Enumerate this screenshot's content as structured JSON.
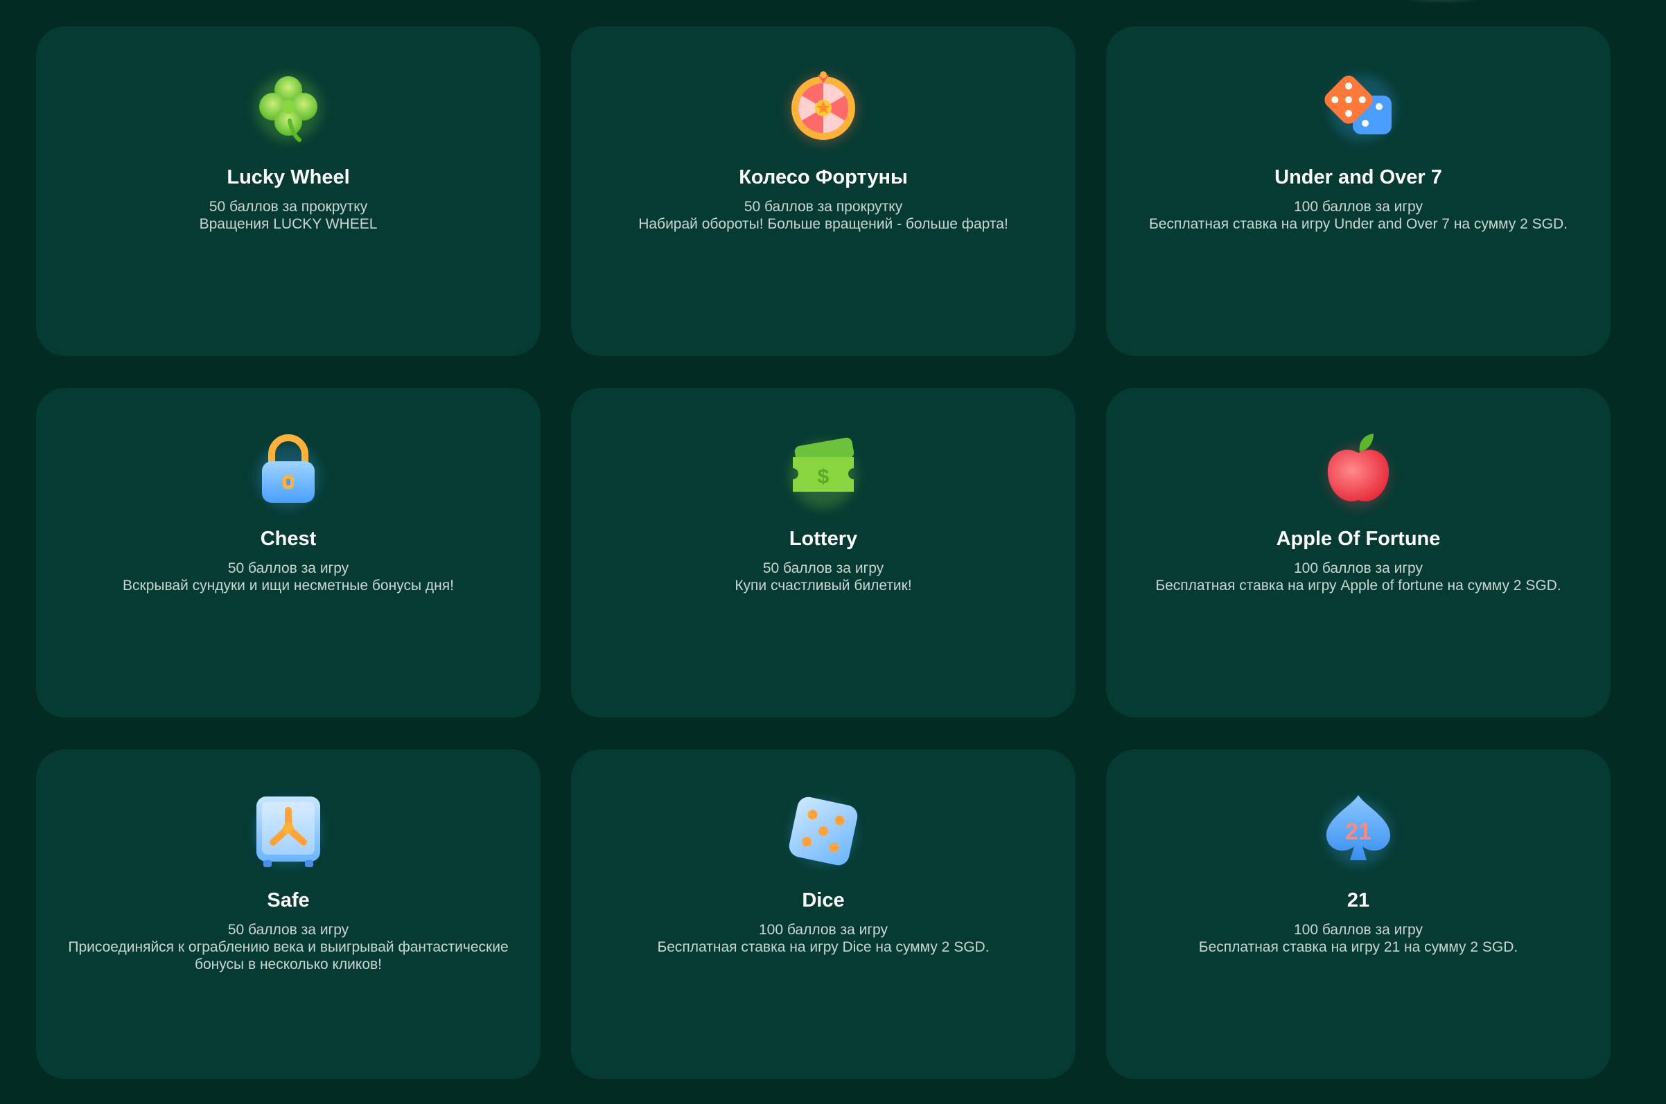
{
  "colors": {
    "background": "#022b23",
    "card": "#063b33",
    "title": "#ffffff",
    "text": "#c9d6d2"
  },
  "cards": [
    {
      "icon": "clover-icon",
      "title": "Lucky Wheel",
      "points": "50 баллов за прокрутку",
      "description": "Вращения LUCKY WHEEL"
    },
    {
      "icon": "fortune-wheel-icon",
      "title": "Колесо Фортуны",
      "points": "50 баллов за прокрутку",
      "description": "Набирай обороты! Больше вращений - больше фарта!"
    },
    {
      "icon": "dice-pair-icon",
      "title": "Under and Over 7",
      "points": "100 баллов за игру",
      "description": "Бесплатная ставка на игру Under and Over 7 на сумму 2 SGD."
    },
    {
      "icon": "padlock-icon",
      "title": "Chest",
      "points": "50 баллов за игру",
      "description": "Вскрывай сундуки и ищи несметные бонусы дня!"
    },
    {
      "icon": "ticket-icon",
      "title": "Lottery",
      "points": "50 баллов за игру",
      "description": "Купи счастливый билетик!"
    },
    {
      "icon": "apple-icon",
      "title": "Apple Of Fortune",
      "points": "100 баллов за игру",
      "description": "Бесплатная ставка на игру Apple of fortune на сумму 2 SGD."
    },
    {
      "icon": "safe-icon",
      "title": "Safe",
      "points": "50 баллов за игру",
      "description": "Присоединяйся к ограблению века и выигрывай фантастические бонусы в несколько кликов!"
    },
    {
      "icon": "dice-icon",
      "title": "Dice",
      "points": "100 баллов за игру",
      "description": "Бесплатная ставка на игру Dice на сумму 2 SGD."
    },
    {
      "icon": "spade-21-icon",
      "title": "21",
      "points": "100 баллов за игру",
      "description": "Бесплатная ставка на игру 21 на сумму 2 SGD."
    }
  ]
}
